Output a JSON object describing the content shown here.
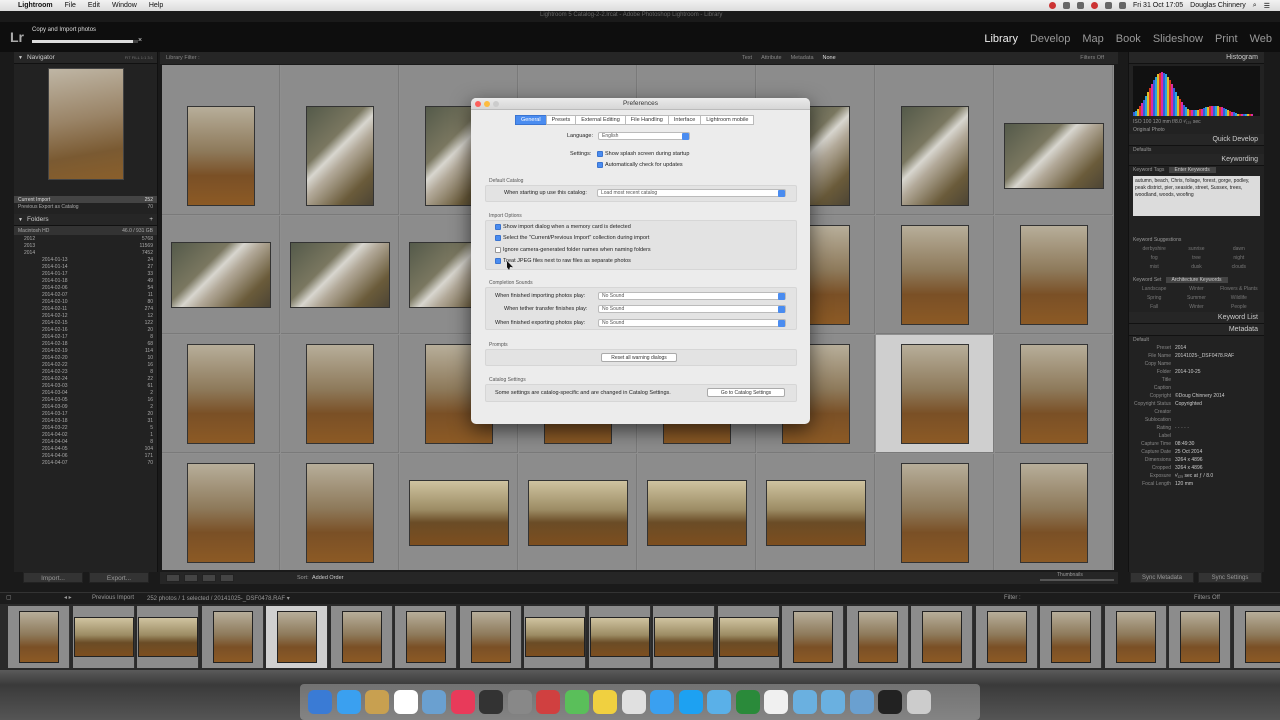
{
  "menubar": {
    "app": "Lightroom",
    "items": [
      "File",
      "Edit",
      "Window",
      "Help"
    ],
    "clock": "Fri 31 Oct  17:05",
    "user": "Douglas Chinnery"
  },
  "window_title": "Lightroom 5 Catalog-2-2.lrcat - Adobe Photoshop Lightroom - Library",
  "lr_top": {
    "logo": "Lr",
    "task_label": "Copy and Import photos",
    "task_progress": 0.95,
    "task_close": "×",
    "modules": [
      "Library",
      "Develop",
      "Map",
      "Book",
      "Slideshow",
      "Print",
      "Web"
    ],
    "active_module": "Library"
  },
  "left_panel": {
    "navigator": "Navigator",
    "nav_opts": "FIT FILL 1:1 3:1",
    "catalog_items": [
      {
        "label": "Current Import",
        "n": "252"
      },
      {
        "label": "Previous Export as Catalog",
        "n": "70"
      }
    ],
    "folders": "Folders",
    "volume": "Macintosh HD",
    "volume_free": "46.0 / 931 GB",
    "years": [
      {
        "label": "2012",
        "n": "5768"
      },
      {
        "label": "2013",
        "n": "11569"
      },
      {
        "label": "2014",
        "n": "7452"
      }
    ],
    "subfolders": [
      {
        "label": "2014-01-13",
        "n": "24"
      },
      {
        "label": "2014-01-14",
        "n": "27"
      },
      {
        "label": "2014-01-17",
        "n": "33"
      },
      {
        "label": "2014-01-18",
        "n": "49"
      },
      {
        "label": "2014-02-06",
        "n": "54"
      },
      {
        "label": "2014-02-07",
        "n": "11"
      },
      {
        "label": "2014-02-10",
        "n": "80"
      },
      {
        "label": "2014-02-11",
        "n": "274"
      },
      {
        "label": "2014-02-12",
        "n": "12"
      },
      {
        "label": "2014-02-15",
        "n": "122"
      },
      {
        "label": "2014-02-16",
        "n": "20"
      },
      {
        "label": "2014-02-17",
        "n": "8"
      },
      {
        "label": "2014-02-18",
        "n": "68"
      },
      {
        "label": "2014-02-19",
        "n": "114"
      },
      {
        "label": "2014-02-20",
        "n": "10"
      },
      {
        "label": "2014-02-22",
        "n": "16"
      },
      {
        "label": "2014-02-23",
        "n": "8"
      },
      {
        "label": "2014-02-24",
        "n": "22"
      },
      {
        "label": "2014-03-03",
        "n": "61"
      },
      {
        "label": "2014-03-04",
        "n": "2"
      },
      {
        "label": "2014-03-05",
        "n": "16"
      },
      {
        "label": "2014-03-09",
        "n": "2"
      },
      {
        "label": "2014-03-17",
        "n": "20"
      },
      {
        "label": "2014-03-18",
        "n": "31"
      },
      {
        "label": "2014-03-22",
        "n": "5"
      },
      {
        "label": "2014-04-02",
        "n": "1"
      },
      {
        "label": "2014-04-04",
        "n": "8"
      },
      {
        "label": "2014-04-05",
        "n": "104"
      },
      {
        "label": "2014-04-06",
        "n": "171"
      },
      {
        "label": "2014-04-07",
        "n": "70"
      }
    ],
    "import_btn": "Import...",
    "export_btn": "Export..."
  },
  "filterbar": {
    "title": "Library Filter :",
    "tabs": [
      "Text",
      "Attribute",
      "Metadata",
      "None"
    ],
    "active": "None",
    "filters_off": "Filters Off"
  },
  "grid": {
    "cells": [
      {
        "row": 0,
        "col": 0,
        "t": "dark-s"
      },
      {
        "row": 0,
        "col": 1,
        "t": "dark-s"
      },
      {
        "row": 0,
        "col": 2,
        "t": "dark-s"
      },
      {
        "row": 0,
        "col": 3,
        "t": "dark-s"
      },
      {
        "row": 0,
        "col": 4,
        "t": "dark-s"
      },
      {
        "row": 0,
        "col": 5,
        "t": "dark-s"
      },
      {
        "row": 0,
        "col": 6,
        "t": "dark-s"
      },
      {
        "row": 0,
        "col": 7,
        "t": "dark-s"
      },
      {
        "row": 1,
        "col": 0,
        "t": "tree-p"
      },
      {
        "row": 1,
        "col": 1,
        "t": "birch"
      },
      {
        "row": 1,
        "col": 2,
        "t": "birch"
      },
      {
        "row": 1,
        "col": 3,
        "t": "birch"
      },
      {
        "row": 1,
        "col": 4,
        "t": "birch"
      },
      {
        "row": 1,
        "col": 5,
        "t": "birch"
      },
      {
        "row": 1,
        "col": 6,
        "t": "birch"
      },
      {
        "row": 1,
        "col": 7,
        "t": "birch-l"
      },
      {
        "row": 2,
        "col": 0,
        "t": "birch-l"
      },
      {
        "row": 2,
        "col": 1,
        "t": "birch-l"
      },
      {
        "row": 2,
        "col": 2,
        "t": "birch-l"
      },
      {
        "row": 2,
        "col": 3,
        "t": "tree-p"
      },
      {
        "row": 2,
        "col": 4,
        "t": "tree-p"
      },
      {
        "row": 2,
        "col": 5,
        "t": "tree-p"
      },
      {
        "row": 2,
        "col": 6,
        "t": "tree-p"
      },
      {
        "row": 2,
        "col": 7,
        "t": "tree-p"
      },
      {
        "row": 3,
        "col": 0,
        "t": "tree-p"
      },
      {
        "row": 3,
        "col": 1,
        "t": "tree-p"
      },
      {
        "row": 3,
        "col": 2,
        "t": "tree-p"
      },
      {
        "row": 3,
        "col": 3,
        "t": "tree-p"
      },
      {
        "row": 3,
        "col": 4,
        "t": "tree-p"
      },
      {
        "row": 3,
        "col": 5,
        "t": "tree-p"
      },
      {
        "row": 3,
        "col": 6,
        "t": "tree-p",
        "sel": true
      },
      {
        "row": 3,
        "col": 7,
        "t": "tree-p"
      },
      {
        "row": 4,
        "col": 0,
        "t": "tree-p"
      },
      {
        "row": 4,
        "col": 1,
        "t": "tree-p"
      },
      {
        "row": 4,
        "col": 2,
        "t": "tree-l"
      },
      {
        "row": 4,
        "col": 3,
        "t": "tree-l"
      },
      {
        "row": 4,
        "col": 4,
        "t": "tree-l"
      },
      {
        "row": 4,
        "col": 5,
        "t": "tree-l"
      },
      {
        "row": 4,
        "col": 6,
        "t": "tree-p"
      },
      {
        "row": 4,
        "col": 7,
        "t": "tree-p"
      }
    ]
  },
  "gridtool": {
    "sort_label": "Sort:",
    "sort_value": "Added Order",
    "thumbs_label": "Thumbnails"
  },
  "right_panel": {
    "histogram": "Histogram",
    "histo_info": "ISO 100   120 mm   f/8.0   ¹⁄₁₂₅ sec",
    "original_photo": "Original Photo",
    "quick_develop": "Quick Develop",
    "qd_default": "Defaults",
    "keywording": "Keywording",
    "kw_tags_label": "Keyword Tags",
    "kw_tags_value": "Enter Keywords",
    "kw_text": "autumn, beach, Chris, foliage, forest, gorge, podley, peak district, pier, seaside, street, Sussex, trees, woodland, woods, woofing",
    "kw_suggest": "Keyword Suggestions",
    "kw_suggestions": [
      "derbyshire",
      "sunrise",
      "dawn",
      "fog",
      "tree",
      "night",
      "mist",
      "dusk",
      "clouds"
    ],
    "kw_set": "Keyword Set",
    "kw_set_value": "Architecture Keywords",
    "kw_set_items": [
      "Landscape",
      "Winter",
      "Flowers & Plants",
      "Spring",
      "Summer",
      "Wildlife",
      "Fall",
      "Winter",
      "People"
    ],
    "keyword_list": "Keyword List",
    "metadata": "Metadata",
    "md_default": "Default",
    "md_rows": [
      {
        "k": "Preset",
        "v": "2014"
      },
      {
        "k": "File Name",
        "v": "20141025-_DSF0478.RAF"
      },
      {
        "k": "Copy Name",
        "v": ""
      },
      {
        "k": "Folder",
        "v": "2014-10-25"
      },
      {
        "k": "Title",
        "v": ""
      },
      {
        "k": "Caption",
        "v": ""
      },
      {
        "k": "Copyright",
        "v": "©Doug Chinnery 2014"
      },
      {
        "k": "Copyright Status",
        "v": "Copyrighted"
      },
      {
        "k": "Creator",
        "v": ""
      },
      {
        "k": "Sublocation",
        "v": ""
      },
      {
        "k": "Rating",
        "v": "· · · · ·"
      },
      {
        "k": "Label",
        "v": ""
      },
      {
        "k": "Capture Time",
        "v": "08:49:30"
      },
      {
        "k": "Capture Date",
        "v": "25 Oct 2014"
      },
      {
        "k": "Dimensions",
        "v": "3264 x 4896"
      },
      {
        "k": "Cropped",
        "v": "3264 x 4896"
      },
      {
        "k": "Exposure",
        "v": "¹⁄₁₂₅ sec at ƒ / 8.0"
      },
      {
        "k": "Focal Length",
        "v": "120 mm"
      }
    ],
    "sync_meta": "Sync Metadata",
    "sync_settings": "Sync Settings"
  },
  "film_info": {
    "source": "Previous Import",
    "count": "252 photos / 1 selected / 20141025-_DSF0478.RAF ▾",
    "filter": "Filter :",
    "filters_off": "Filters Off"
  },
  "film": {
    "thumbs": [
      "tree-p",
      "tree-l",
      "tree-l",
      "tree-p",
      "tree-p",
      "tree-p",
      "tree-p",
      "tree-p",
      "tree-l",
      "tree-l",
      "tree-l",
      "tree-l",
      "tree-p",
      "tree-p",
      "tree-p",
      "tree-p",
      "tree-p",
      "tree-p",
      "tree-p",
      "tree-p"
    ],
    "selected": 4
  },
  "dock": {
    "icons": [
      "#3a7bd5",
      "#3aa0f0",
      "#c8a050",
      "#ffffff",
      "#6aa0d0",
      "#e83a5a",
      "#333333",
      "#888888",
      "#d04040",
      "#5abf5a",
      "#f0d040",
      "#e0e0e0",
      "#3aa0f0",
      "#1da1f2",
      "#5ab0e8",
      "#2a8a3a",
      "#f0f0f0",
      "#6ab0e0",
      "#6ab0e0",
      "#6aa0d0",
      "#222222",
      "#cccccc"
    ]
  },
  "prefs": {
    "title": "Preferences",
    "tabs": [
      "General",
      "Presets",
      "External Editing",
      "File Handling",
      "Interface",
      "Lightroom mobile"
    ],
    "active_tab": "General",
    "language_label": "Language:",
    "language_value": "English",
    "settings_label": "Settings:",
    "show_splash": "Show splash screen during startup",
    "auto_check": "Automatically check for updates",
    "default_catalog": "Default Catalog",
    "startup_label": "When starting up use this catalog:",
    "startup_value": "Load most recent catalog",
    "import_options": "Import Options",
    "opt1": "Show import dialog when a memory card is detected",
    "opt2": "Select the \"Current/Previous Import\" collection during import",
    "opt3": "Ignore camera-generated folder names when naming folders",
    "opt4": "Treat JPEG files next to raw files as separate photos",
    "completion_sounds": "Completion Sounds",
    "snd1_label": "When finished importing photos play:",
    "snd2_label": "When tether transfer finishes play:",
    "snd3_label": "When finished exporting photos play:",
    "no_sound": "No Sound",
    "prompts": "Prompts",
    "reset_btn": "Reset all warning dialogs",
    "catalog_settings": "Catalog Settings",
    "cs_text": "Some settings are catalog-specific and are changed in Catalog Settings.",
    "cs_btn": "Go to Catalog Settings"
  }
}
